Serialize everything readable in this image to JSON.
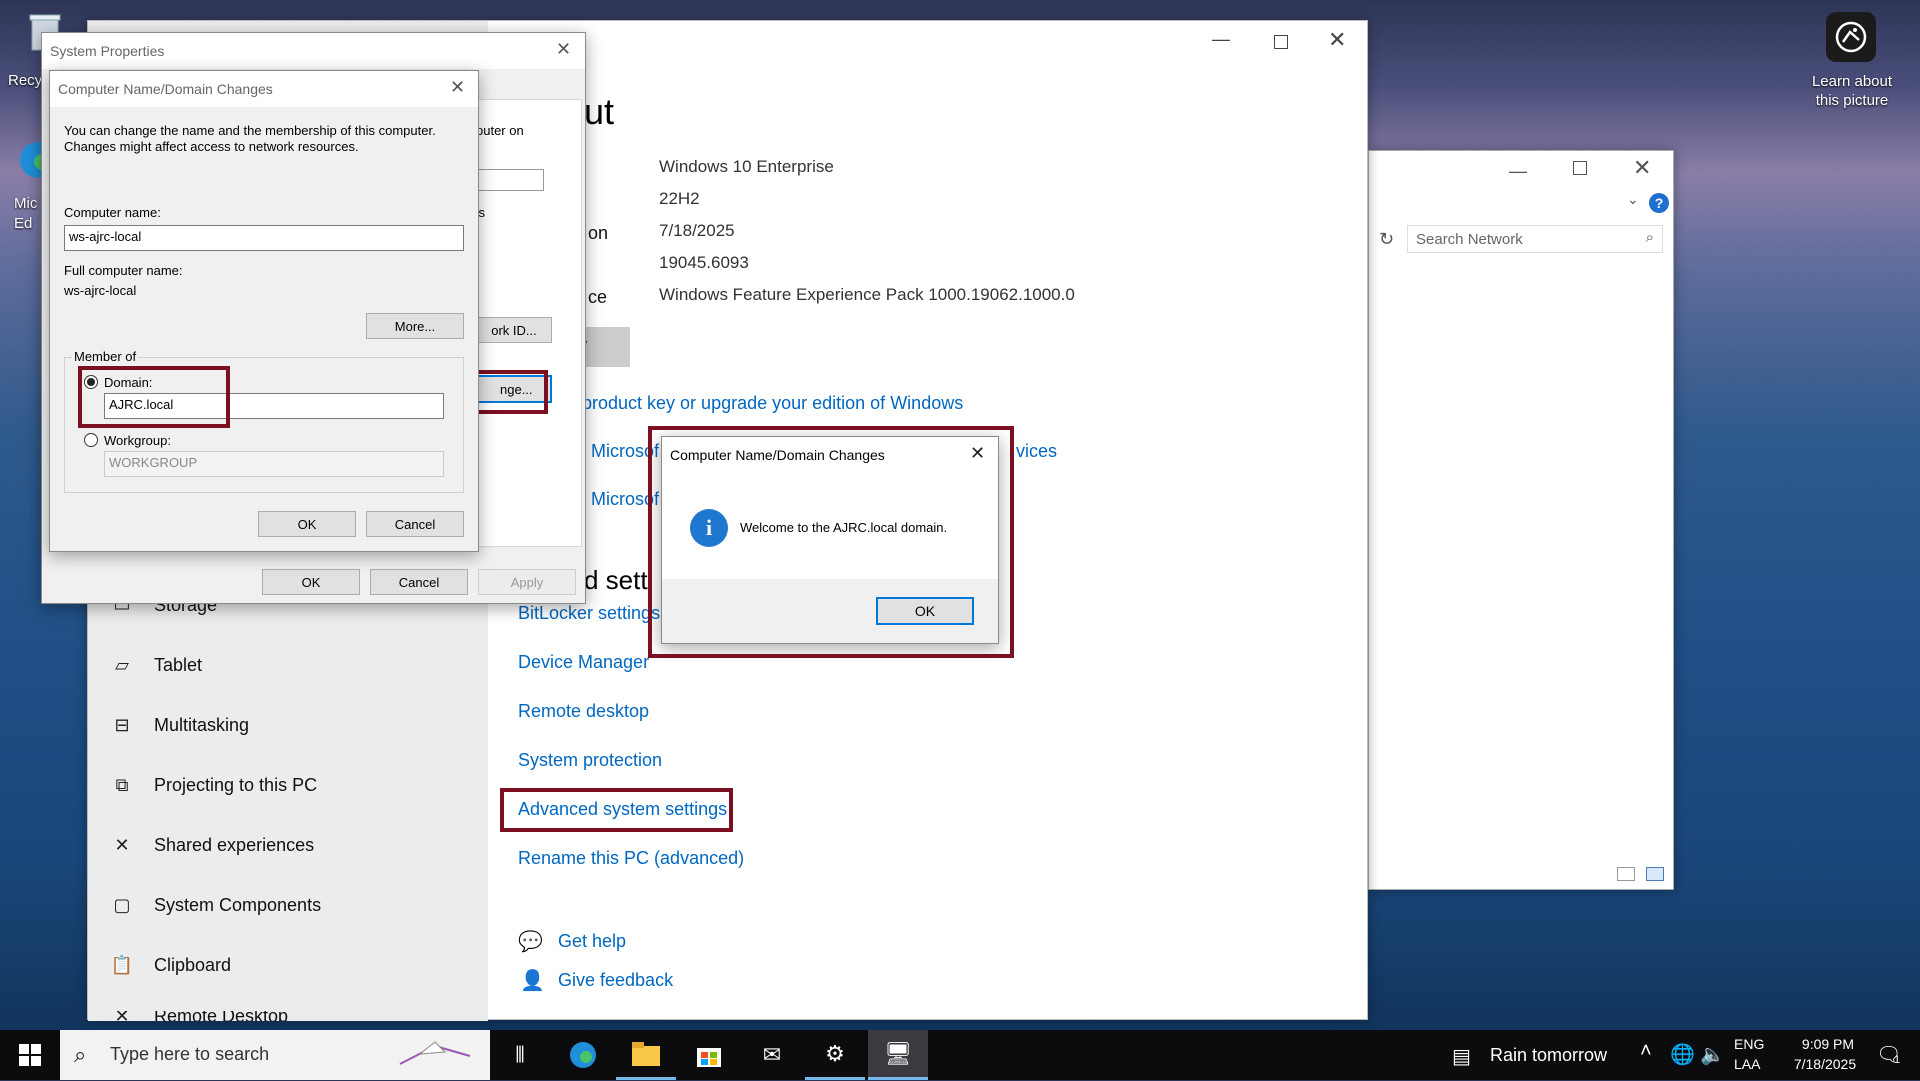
{
  "desktop": {
    "recycle_label": "Recy",
    "edge_label": "Mic\nEd",
    "learn_label": "Learn about this picture"
  },
  "about_window": {
    "heading_fragment": "ut",
    "specs": [
      {
        "label_fragment": "",
        "value": "Windows 10 Enterprise"
      },
      {
        "label_fragment": "",
        "value": "22H2"
      },
      {
        "label_fragment": "on",
        "value": "7/18/2025"
      },
      {
        "label_fragment": "",
        "value": "19045.6093"
      },
      {
        "label_fragment": "ce",
        "value": "Windows Feature Experience Pack 1000.19062.1000.0"
      }
    ],
    "copy_btn_fragment": "y",
    "product_key_link": "product key or upgrade your edition of Windows",
    "ms_link_1": "Microsof",
    "ms_link_1_tail": "vices",
    "ms_link_2": "Microsof",
    "related_heading_fragment": "d setti",
    "links": [
      "BitLocker settings",
      "Device Manager",
      "Remote desktop",
      "System protection",
      "Advanced system settings",
      "Rename this PC (advanced)"
    ],
    "help": "Get help",
    "feedback": "Give feedback"
  },
  "settings_nav": [
    "Storage",
    "Tablet",
    "Multitasking",
    "Projecting to this PC",
    "Shared experiences",
    "System Components",
    "Clipboard",
    "Remote Desktop"
  ],
  "network_window": {
    "search_placeholder": "Search Network"
  },
  "system_properties": {
    "title": "System Properties",
    "frag_computer_on": "puter on",
    "frag_s": "'s",
    "frag_network_id": "ork ID...",
    "frag_change": "nge...",
    "ok": "OK",
    "cancel": "Cancel",
    "apply": "Apply"
  },
  "name_changes": {
    "title": "Computer Name/Domain Changes",
    "intro": "You can change the name and the membership of this computer. Changes might affect access to network resources.",
    "computer_name_label": "Computer name:",
    "computer_name_value": "ws-ajrc-local",
    "full_name_label": "Full computer name:",
    "full_name_value": "ws-ajrc-local",
    "more_btn": "More...",
    "member_of": "Member of",
    "domain_label": "Domain:",
    "domain_value": "AJRC.local",
    "workgroup_label": "Workgroup:",
    "workgroup_value": "WORKGROUP",
    "ok": "OK",
    "cancel": "Cancel"
  },
  "welcome_dialog": {
    "title": "Computer Name/Domain Changes",
    "message": "Welcome to the AJRC.local domain.",
    "ok": "OK"
  },
  "taskbar": {
    "search_placeholder": "Type here to search",
    "weather": "Rain tomorrow",
    "lang_1": "ENG",
    "lang_2": "LAA",
    "time": "9:09 PM",
    "date": "7/18/2025",
    "notif_count": "1"
  }
}
